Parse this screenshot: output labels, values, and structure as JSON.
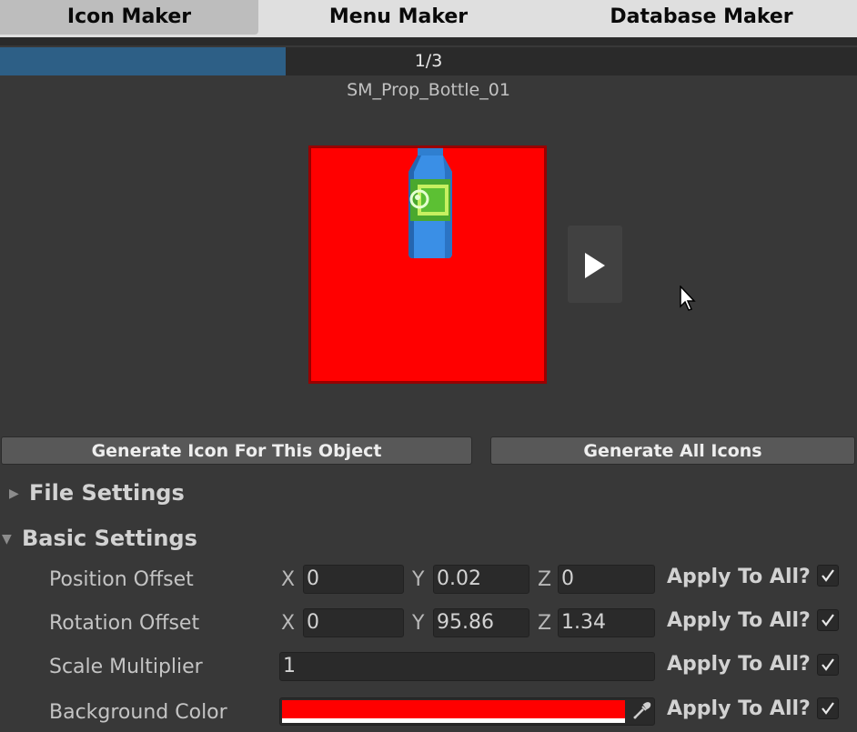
{
  "tabs": [
    {
      "label": "Icon Maker",
      "active": true
    },
    {
      "label": "Menu Maker",
      "active": false
    },
    {
      "label": "Database Maker",
      "active": false
    }
  ],
  "progress": {
    "text": "1/3",
    "value": 0.333
  },
  "object_name": "SM_Prop_Bottle_01",
  "preview": {
    "background_color": "#ff0000",
    "icon": "bottle-icon"
  },
  "buttons": {
    "generate_this": "Generate Icon For This Object",
    "generate_all": "Generate All Icons",
    "play_icon": "play-icon"
  },
  "foldouts": {
    "file_settings": {
      "label": "File Settings",
      "expanded": false
    },
    "basic_settings": {
      "label": "Basic Settings",
      "expanded": true
    }
  },
  "rows": {
    "position": {
      "label": "Position Offset",
      "x": "0",
      "y": "0.02",
      "z": "0",
      "apply": "Apply To All?",
      "checked": true
    },
    "rotation": {
      "label": "Rotation Offset",
      "x": "0",
      "y": "95.86",
      "z": "1.34",
      "apply": "Apply To All?",
      "checked": true
    },
    "scale": {
      "label": "Scale Multiplier",
      "value": "1",
      "apply": "Apply To All?",
      "checked": true
    },
    "background": {
      "label": "Background Color",
      "color": "#ff0000",
      "apply": "Apply To All?",
      "checked": true
    }
  },
  "axes": {
    "x": "X",
    "y": "Y",
    "z": "Z"
  }
}
